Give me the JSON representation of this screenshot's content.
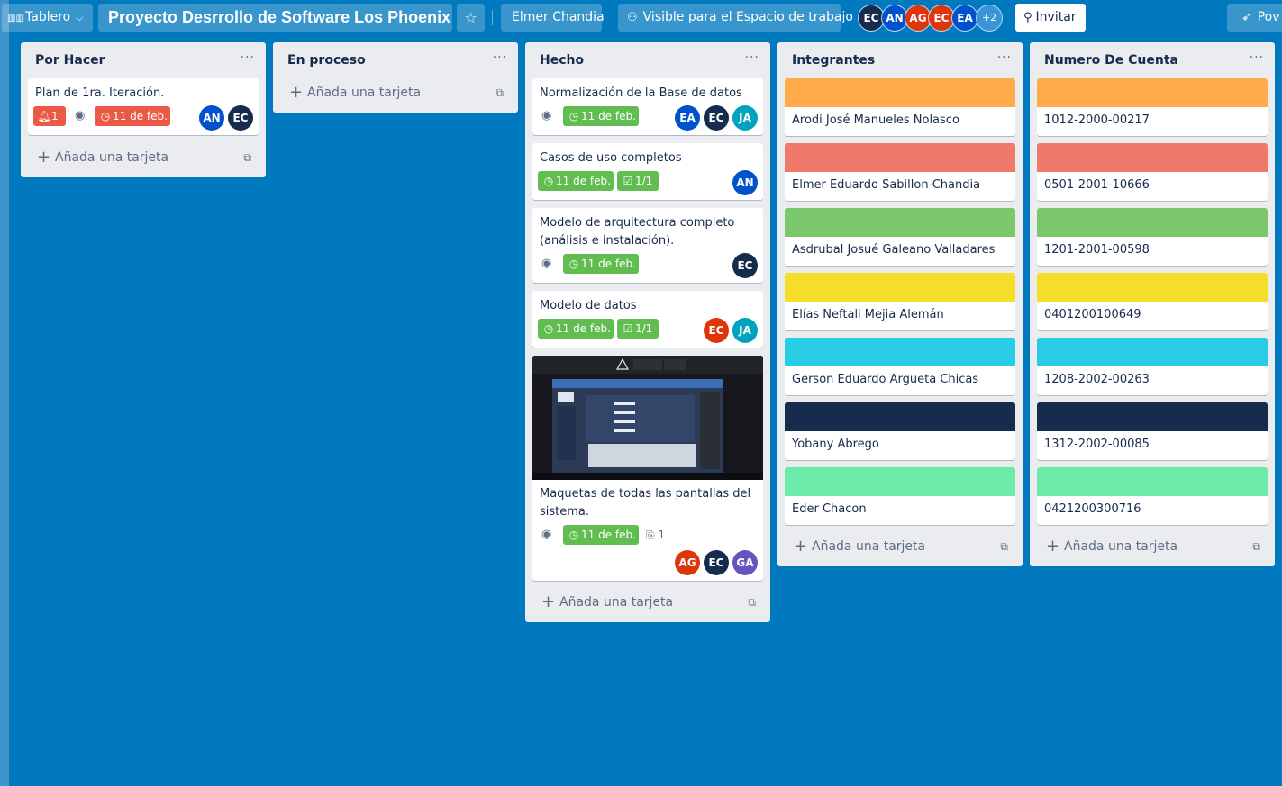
{
  "colors": {
    "board_bg": "#0079bf",
    "green": "#61bd4f",
    "red": "#eb5a46",
    "orange": "#ffab4a",
    "salmon": "#f07969",
    "lime": "#7bc86c",
    "yellow": "#f5dd29",
    "sky": "#29cce5",
    "navy": "#172b4d",
    "mint": "#6deca9"
  },
  "header": {
    "board_switcher_icon": "board-icon",
    "board_switcher_label": "Tablero",
    "board_title": "Proyecto Desrrollo de Software Los Phoenix",
    "star_icon": "star-icon",
    "team_label": "Elmer Chandia",
    "visibility_label": "Visible para el Espacio de trabajo",
    "members": [
      "EC",
      "AN",
      "AG",
      "EC",
      "EA"
    ],
    "members_more": "+2",
    "invite_label": "Invitar",
    "right_button_label": "Pov"
  },
  "lists": {
    "por_hacer": {
      "title": "Por Hacer",
      "cards": [
        {
          "text": "Plan de 1ra. Iteración.",
          "notification_count": "1",
          "due": "11 de feb.",
          "members": [
            "AN",
            "EC"
          ]
        }
      ],
      "add_label": "Añada una tarjeta"
    },
    "en_proceso": {
      "title": "En proceso",
      "add_label": "Añada una tarjeta"
    },
    "hecho": {
      "title": "Hecho",
      "cards": [
        {
          "text": "Normalización de la Base de datos",
          "due": "11 de feb.",
          "members": [
            "EA",
            "EC",
            "JA"
          ]
        },
        {
          "text": "Casos de uso completos",
          "due": "11 de feb.",
          "checklist": "1/1",
          "members": [
            "AN"
          ]
        },
        {
          "text": "Modelo de arquitectura completo (análisis e instalación).",
          "due": "11 de feb.",
          "members": [
            "EC"
          ]
        },
        {
          "text": "Modelo de datos",
          "due": "11 de feb.",
          "checklist": "1/1",
          "members": [
            "EC",
            "JA"
          ]
        },
        {
          "text": "Maquetas de todas las pantallas del sistema.",
          "due": "11 de feb.",
          "attachments": "1",
          "members": [
            "AG",
            "EC",
            "GA"
          ]
        }
      ],
      "add_label": "Añada una tarjeta"
    },
    "integrantes": {
      "title": "Integrantes",
      "cards": [
        "Arodi José Manueles Nolasco",
        "Elmer Eduardo Sabillon Chandia",
        "Asdrubal Josué Galeano Valladares",
        "Elías Neftali Mejia Alemán",
        "Gerson Eduardo Argueta Chicas",
        "Yobany Abrego",
        "Eder Chacon"
      ],
      "add_label": "Añada una tarjeta"
    },
    "numero_cuenta": {
      "title": "Numero De Cuenta",
      "cards": [
        "1012-2000-00217",
        "0501-2001-10666",
        "1201-2001-00598",
        "0401200100649",
        "1208-2002-00263",
        "1312-2002-00085",
        "0421200300716"
      ],
      "add_label": "Añada una tarjeta"
    }
  },
  "menu_icon": "more-icon"
}
